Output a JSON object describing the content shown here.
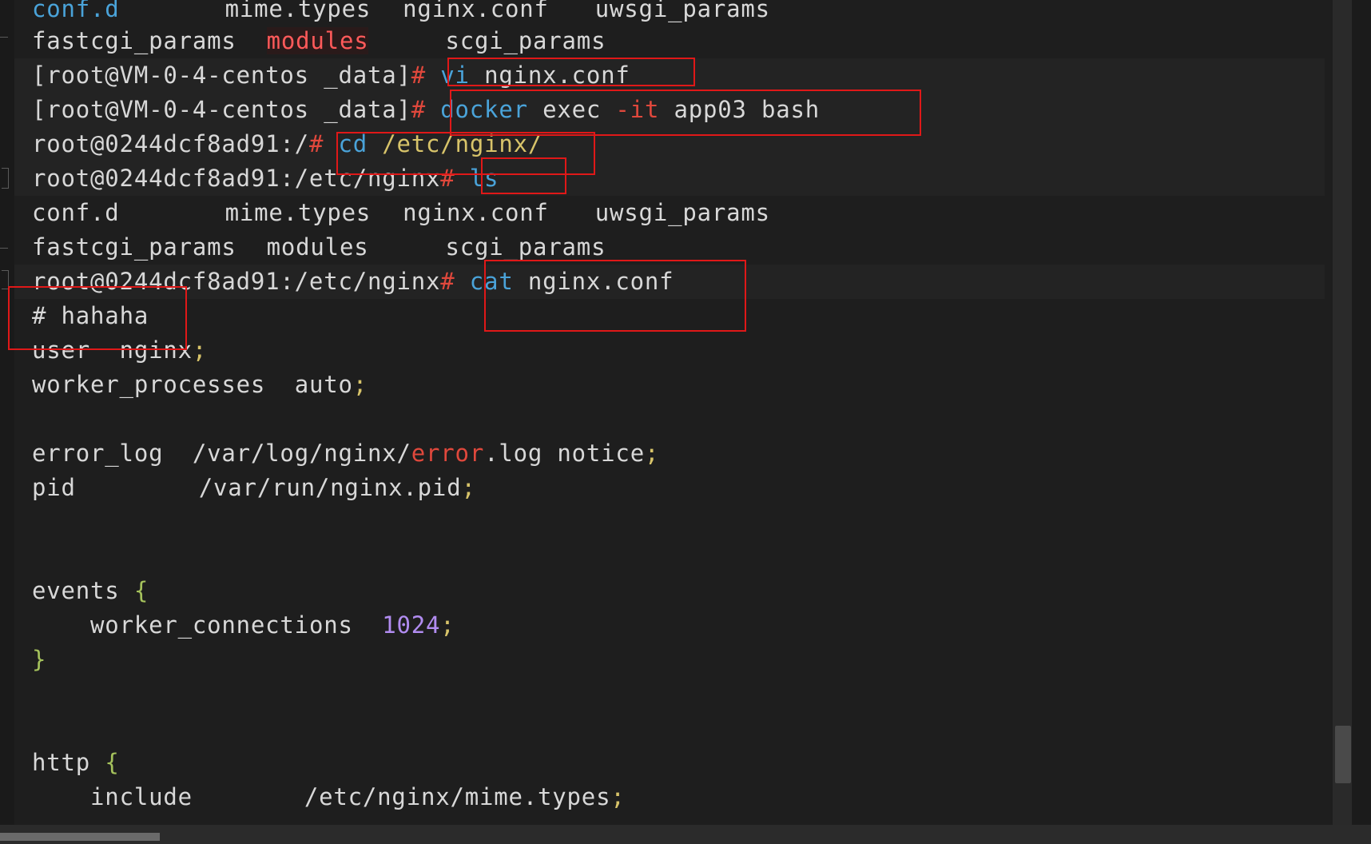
{
  "terminal": {
    "line0": {
      "c1": "conf.d",
      "c2": "mime.types",
      "c3": "nginx.conf",
      "c4": "uwsgi_params"
    },
    "line1": {
      "c1": "fastcgi_params",
      "c2": "modules",
      "c3": "scgi_params"
    },
    "line2": {
      "prompt": "[root@VM-0-4-centos _data]",
      "hash": "#",
      "cmd": "vi",
      "arg": "nginx.conf"
    },
    "line3": {
      "prompt": "[root@VM-0-4-centos _data]",
      "hash": "#",
      "cmd": "docker",
      "arg1": "exec",
      "flag": "-it",
      "arg2": "app03 bash"
    },
    "line4": {
      "prompt": "root@0244dcf8ad91:/",
      "hash": "#",
      "cmd": "cd",
      "arg": "/etc/nginx/"
    },
    "line5": {
      "prompt": "root@0244dcf8ad91:/etc/nginx",
      "hash": "#",
      "cmd": "ls"
    },
    "line6": {
      "c1": "conf.d",
      "c2": "mime.types",
      "c3": "nginx.conf",
      "c4": "uwsgi_params"
    },
    "line7": {
      "c1": "fastcgi_params",
      "c2": "modules",
      "c3": "scgi_params"
    },
    "line8": {
      "prompt": "root@0244dcf8ad91:/etc/nginx",
      "hash": "#",
      "cmd": "cat",
      "arg": "nginx.conf"
    },
    "line9": {
      "hash": "#",
      "text": "hahaha"
    },
    "line10": {
      "key": "user",
      "val": "nginx",
      "semi": ";"
    },
    "line11": {
      "key": "worker_processes",
      "val": "auto",
      "semi": ";"
    },
    "line13": {
      "key": "error_log",
      "p1": "/var/log/nginx/",
      "err": "error",
      "p2": ".log notice",
      "semi": ";"
    },
    "line14": {
      "key": "pid",
      "val": "/var/run/nginx.pid",
      "semi": ";"
    },
    "line17": {
      "key": "events",
      "brace": "{"
    },
    "line18": {
      "key": "worker_connections",
      "num": "1024",
      "semi": ";"
    },
    "line19": {
      "brace": "}"
    },
    "line22": {
      "key": "http",
      "brace": "{"
    },
    "line23": {
      "key": "include",
      "val": "/etc/nginx/mime.types",
      "semi": ";"
    }
  }
}
